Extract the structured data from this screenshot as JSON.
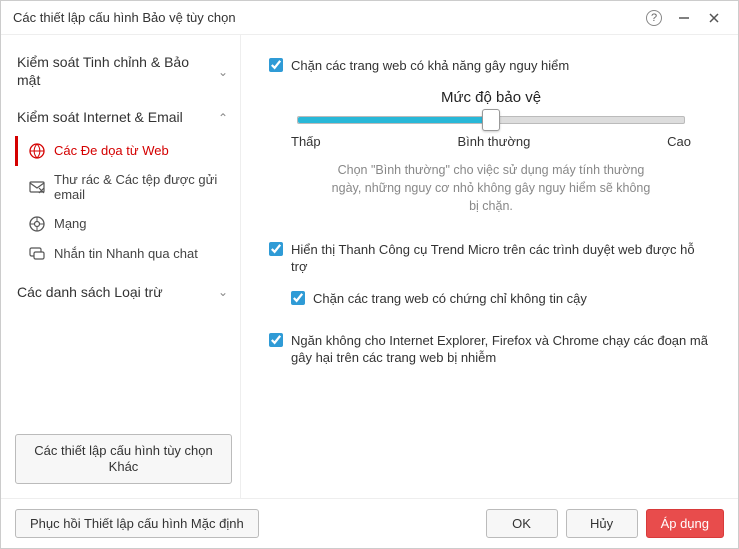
{
  "window": {
    "title": "Các thiết lập cấu hình Bảo vệ tùy chọn"
  },
  "sidebar": {
    "sections": [
      {
        "label": "Kiểm soát Tinh chỉnh & Bảo mật",
        "expanded": false
      },
      {
        "label": "Kiểm soát Internet & Email",
        "expanded": true,
        "items": [
          {
            "label": "Các Đe dọa từ Web",
            "icon": "globe-alert-icon",
            "active": true
          },
          {
            "label": "Thư rác & Các tệp được gửi email",
            "icon": "mail-cross-icon",
            "active": false
          },
          {
            "label": "Mạng",
            "icon": "network-icon",
            "active": false
          },
          {
            "label": "Nhắn tin Nhanh qua chat",
            "icon": "chat-icon",
            "active": false
          }
        ]
      },
      {
        "label": "Các danh sách Loại trừ",
        "expanded": false
      }
    ],
    "other_settings_btn": "Các thiết lập cấu hình tùy chọn Khác"
  },
  "content": {
    "block_dangerous_sites": {
      "checked": true,
      "label": "Chặn các trang web có khả năng gây nguy hiểm"
    },
    "slider": {
      "title": "Mức độ bảo vệ",
      "low": "Thấp",
      "mid": "Bình thường",
      "high": "Cao",
      "hint": "Chọn \"Bình thường\" cho việc sử dụng máy tính thường ngày, những nguy cơ nhỏ không gây nguy hiểm sẽ không bị chặn."
    },
    "show_toolbar": {
      "checked": true,
      "label": "Hiển thị Thanh Công cụ Trend Micro trên các trình duyệt web được hỗ trợ"
    },
    "block_untrusted_cert": {
      "checked": true,
      "label": "Chặn các trang web có chứng chỉ không tin cậy"
    },
    "block_scripts": {
      "checked": true,
      "label": "Ngăn không cho Internet Explorer, Firefox và Chrome chạy các đoạn mã gây hại trên các trang web bị nhiễm"
    }
  },
  "footer": {
    "restore": "Phục hồi Thiết lập cấu hình Mặc định",
    "ok": "OK",
    "cancel": "Hủy",
    "apply": "Áp dụng"
  }
}
